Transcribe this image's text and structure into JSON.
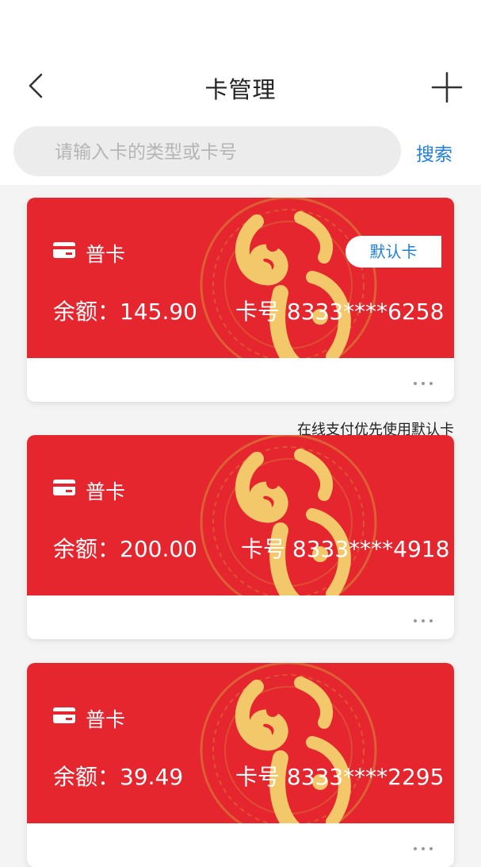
{
  "header": {
    "title": "卡管理",
    "back_icon": "chevron-left-icon",
    "add_icon": "plus-icon"
  },
  "search": {
    "placeholder": "请输入卡的类型或卡号",
    "value": "",
    "button_label": "搜索"
  },
  "cards": [
    {
      "type": "普卡",
      "balance": "余额：145.90",
      "card_number": "卡号 8333****6258",
      "default_badge": "默认卡"
    },
    {
      "type": "普卡",
      "balance": "余额：200.00",
      "card_number": "卡号 8333****4918"
    },
    {
      "type": "普卡",
      "balance": "余额：39.49",
      "card_number": "卡号 8333****2295"
    }
  ],
  "default_tip": "在线支付优先使用默认卡",
  "colors": {
    "card_red": "#e5262e",
    "accent_blue": "#1d7fe0",
    "gold": "#f2c86a"
  }
}
